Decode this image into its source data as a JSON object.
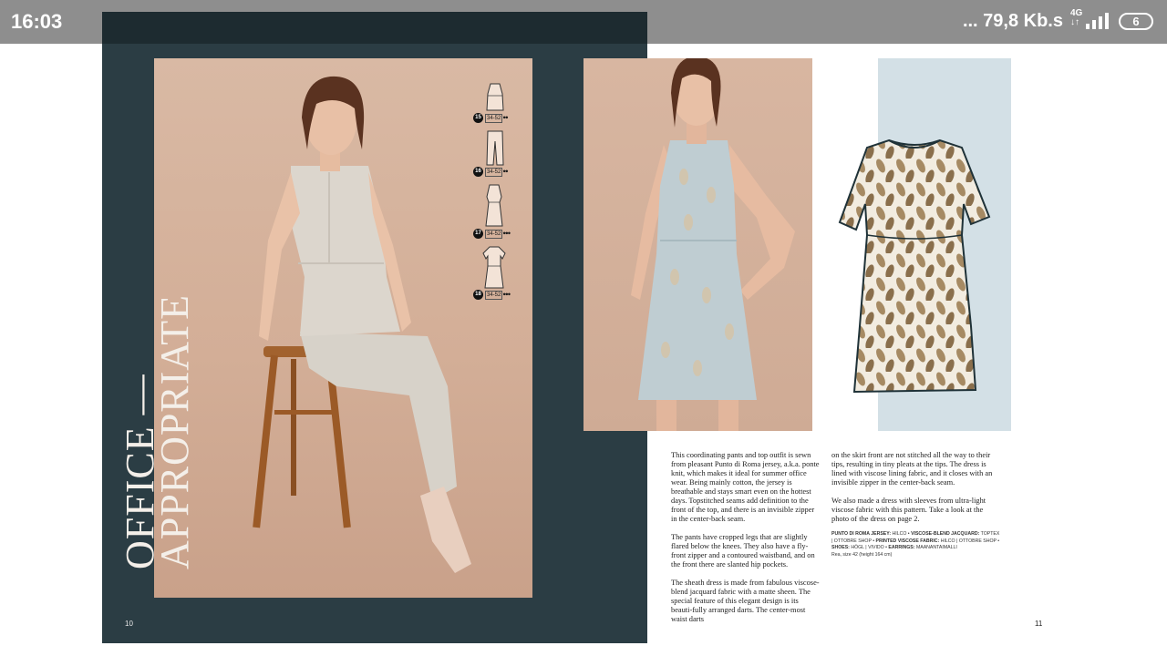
{
  "status_bar": {
    "time": "16:03",
    "network": "... 79,8 Kb.s",
    "network_type": "4G",
    "battery": "6"
  },
  "left_page": {
    "title_line1": "OFFICE —",
    "title_line2": "APPROPRIATE",
    "page_number": "10",
    "patterns": [
      {
        "number": "15",
        "sizes": "34-52",
        "difficulty": "●●"
      },
      {
        "number": "16",
        "sizes": "34-52",
        "difficulty": "●●"
      },
      {
        "number": "17",
        "sizes": "34-52",
        "difficulty": "●●●"
      },
      {
        "number": "18",
        "sizes": "34-52",
        "difficulty": "●●●"
      }
    ]
  },
  "right_page": {
    "page_number": "11",
    "col1": [
      "This coordinating pants and top outfit is sewn from pleasant Punto di Roma jersey, a.k.a. ponte knit, which makes it ideal for summer office wear. Being mainly cotton, the jersey is breathable and stays smart even on the hottest days. Topstitched seams add definition to the front of the top, and there is an invisible zipper in the center-back seam.",
      "The pants have cropped legs that are slightly flared below the knees. They also have a fly-front zipper and a contoured waistband, and on the front there are slanted hip pockets.",
      "The sheath dress is made from fabulous viscose-blend jacquard fabric with a matte sheen. The special feature of this elegant design is its beauti-fully arranged darts. The center-most waist darts"
    ],
    "col2": [
      "on the skirt front are not stitched all the way to their tips, resulting in tiny pleats at the tips. The dress is lined with viscose lining fabric, and it closes with an invisible zipper in the center-back seam.",
      "We also made a dress with sleeves from ultra-light viscose fabric with this pattern. Take a look at the photo of the dress on page 2."
    ],
    "credits": {
      "l1_label": "PUNTO DI ROMA JERSEY:",
      "l1_value": "HILCO",
      "l2_label": "VISCOSE-BLEND JACQUARD:",
      "l2_value": "TOPTEX | OTTOBRE SHOP",
      "l3_label": "PRINTED VISCOSE FABRIC:",
      "l3_value": "HILCO | OTTOBRE SHOP",
      "l4_label": "SHOES:",
      "l4_value": "HÖGL | VIVIDO",
      "l5_label": "EARRINGS:",
      "l5_value": "MAANANTAIMALLI",
      "model_note": "Rea, size 42 (height 164 cm)"
    }
  },
  "colors": {
    "status_bar": "#8e8e8e",
    "left_page_bg": "#2b3d44",
    "photo_bg": "#d3ae97",
    "sketch_panel": "#d3e0e6"
  }
}
